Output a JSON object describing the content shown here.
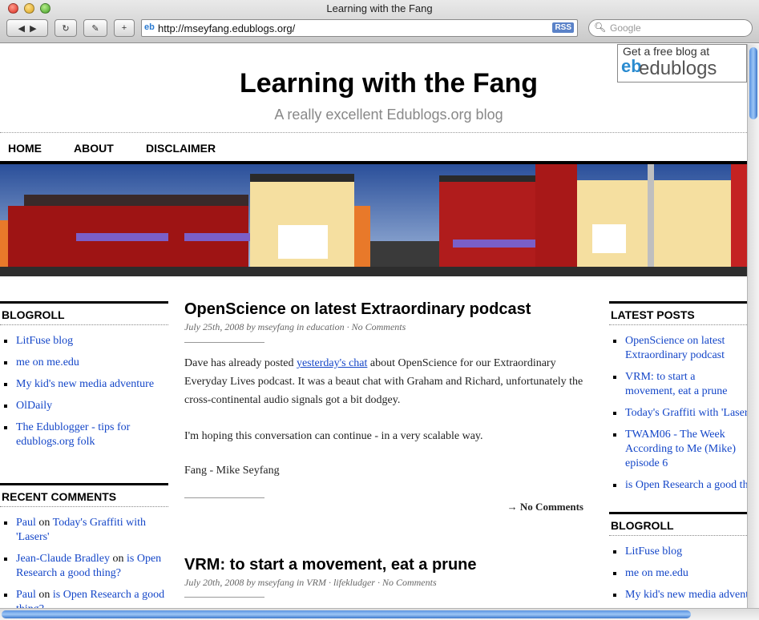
{
  "browser": {
    "window_title": "Learning with the Fang",
    "url": "http://mseyfang.edublogs.org/",
    "rss_label": "RSS",
    "search_placeholder": "Google"
  },
  "badge": {
    "line1": "Get a free blog at",
    "brand": "edublogs"
  },
  "site": {
    "title": "Learning with the Fang",
    "tagline": "A really excellent Edublogs.org blog"
  },
  "nav": [
    "HOME",
    "ABOUT",
    "DISCLAIMER"
  ],
  "left_sidebar": {
    "blogroll_title": "BLOGROLL",
    "blogroll": [
      "LitFuse blog",
      "me on me.edu",
      "My kid's new media adventure",
      "OlDaily",
      "The Edublogger - tips for edublogs.org folk"
    ],
    "comments_title": "RECENT COMMENTS",
    "comments": [
      {
        "author": "Paul",
        "on": "on",
        "post": "Today's Graffiti with 'Lasers'"
      },
      {
        "author": "Jean-Claude Bradley",
        "on": "on",
        "post": "is Open Research a good thing?"
      },
      {
        "author": "Paul",
        "on": "on",
        "post": "is Open Research a good thing?"
      }
    ]
  },
  "posts": [
    {
      "title": "OpenScience on latest Extraordinary podcast",
      "date": "July 25th, 2008 by mseyfang in education ·",
      "comments_link": "No Comments",
      "p1_before": "Dave has already posted ",
      "p1_link": "yesterday's chat",
      "p1_after": " about OpenScience for our Extraordinary Everyday Lives podcast. It was a beaut chat with Graham and Richard, unfortunately the cross-continental audio signals got a bit dodgey.",
      "p2": "I'm hoping this conversation can continue - in a very scalable way.",
      "p3": "Fang - Mike Seyfang",
      "footer_comments": "→ No Comments"
    },
    {
      "title": "VRM: to start a movement, eat a prune",
      "date": "July 20th, 2008 by mseyfang in VRM · lifekludger ·",
      "comments_link": "No Comments"
    }
  ],
  "right_sidebar": {
    "latest_title": "LATEST POSTS",
    "latest": [
      "OpenScience on latest Extraordinary podcast",
      "VRM: to start a movement, eat a prune",
      "Today's Graffiti with 'Lasers'",
      "TWAM06 - The Week According to Me (Mike) episode 6",
      "is Open Research a good thing?"
    ],
    "blogroll_title": "BLOGROLL",
    "blogroll": [
      "LitFuse blog",
      "me on me.edu",
      "My kid's new media adventure"
    ]
  }
}
